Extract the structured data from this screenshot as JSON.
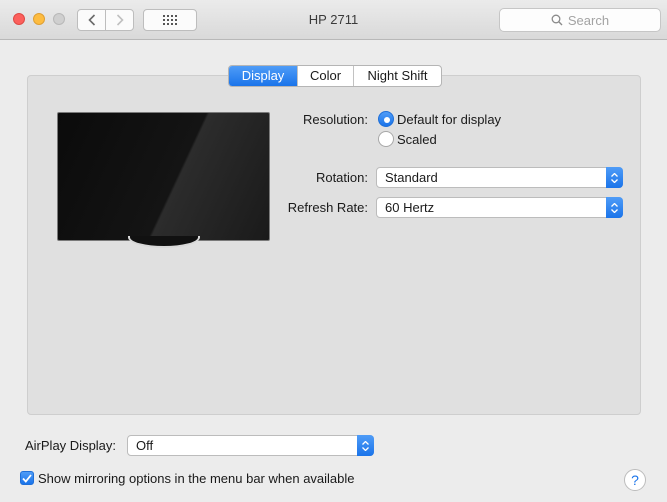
{
  "window": {
    "title": "HP 2711"
  },
  "toolbar": {
    "back_icon": "chevron-left-icon",
    "forward_icon": "chevron-right-icon",
    "show_all_icon": "grid-icon",
    "search_placeholder": "Search"
  },
  "tabs": [
    {
      "label": "Display",
      "active": true
    },
    {
      "label": "Color",
      "active": false
    },
    {
      "label": "Night Shift",
      "active": false
    }
  ],
  "display": {
    "resolution_label": "Resolution:",
    "resolution_options": [
      {
        "label": "Default for display",
        "selected": true
      },
      {
        "label": "Scaled",
        "selected": false
      }
    ],
    "rotation_label": "Rotation:",
    "rotation_value": "Standard",
    "refresh_label": "Refresh Rate:",
    "refresh_value": "60 Hertz"
  },
  "airplay": {
    "label": "AirPlay Display:",
    "value": "Off"
  },
  "mirroring": {
    "label": "Show mirroring options in the menu bar when available",
    "checked": true
  },
  "help": {
    "label": "?"
  },
  "colors": {
    "accent": "#1a74ea",
    "close": "#fc605c",
    "minimize": "#fdbc40",
    "zoom_disabled": "#cfcfcf"
  }
}
